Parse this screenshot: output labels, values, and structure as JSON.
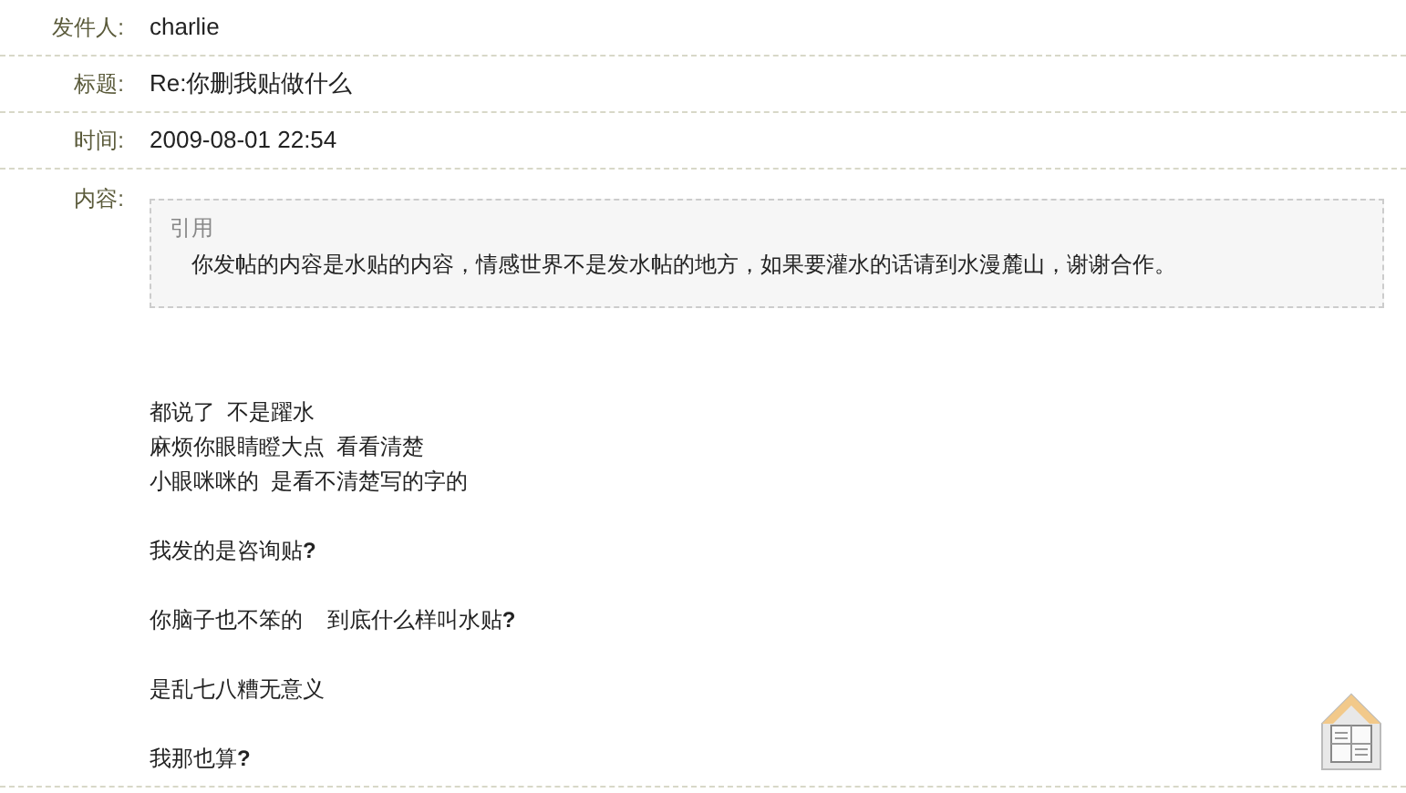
{
  "fields": [
    {
      "label": "发件人:",
      "value": "charlie"
    },
    {
      "label": "标题:",
      "value": "Re:你删我贴做什么"
    },
    {
      "label": "时间:",
      "value": "2009-08-01 22:54"
    }
  ],
  "content": {
    "label": "内容:",
    "quote": {
      "title": "引用",
      "text": "你发帖的内容是水贴的内容，情感世界不是发水帖的地方，如果要灌水的话请到水漫麓山，谢谢合作。"
    },
    "paragraphs": [
      [
        "都说了  不是躍水",
        "麻烦你眼睛瞪大点  看看清楚",
        "小眼咪咪的  是看不清楚写的字的"
      ],
      [
        "我发的是咨询贴**?**"
      ],
      [
        "你脑子也不笨的    到底什么样叫水贴**?**"
      ],
      [
        "是乱七八糟无意义"
      ],
      [
        "我那也算**?**"
      ]
    ]
  }
}
